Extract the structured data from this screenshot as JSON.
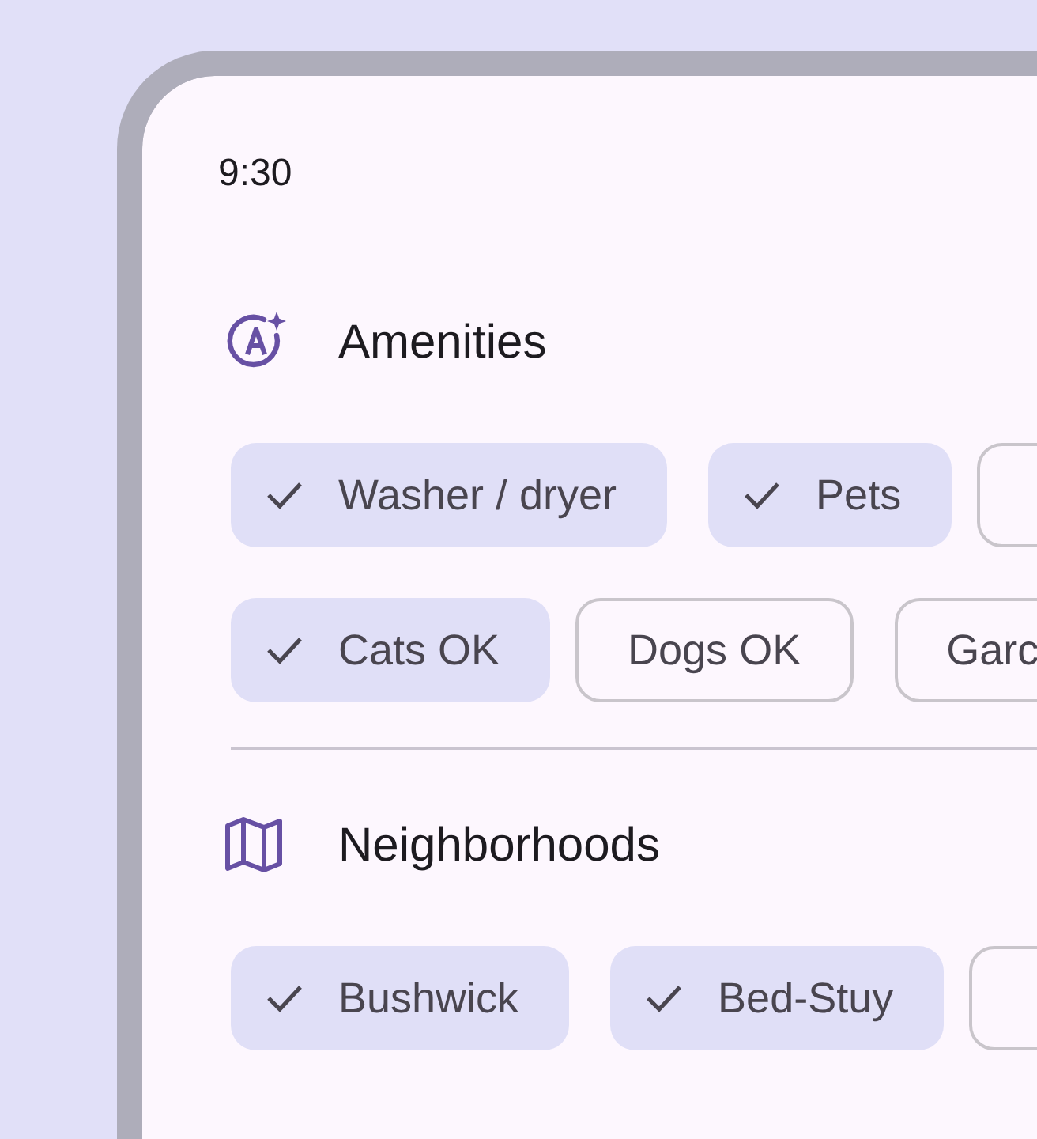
{
  "status_bar": {
    "time": "9:30"
  },
  "sections": [
    {
      "title": "Amenities",
      "rows": [
        [
          {
            "label": "Washer / dryer",
            "selected": true
          },
          {
            "label": "Pets",
            "selected": true
          },
          {
            "selected": false
          }
        ],
        [
          {
            "label": "Cats OK",
            "selected": true
          },
          {
            "label": "Dogs OK",
            "selected": false
          },
          {
            "label": "Garc",
            "selected": false
          }
        ]
      ]
    },
    {
      "title": "Neighborhoods",
      "rows": [
        [
          {
            "label": "Bushwick",
            "selected": true
          },
          {
            "label": "Bed-Stuy",
            "selected": true
          },
          {
            "selected": false
          }
        ]
      ]
    }
  ]
}
